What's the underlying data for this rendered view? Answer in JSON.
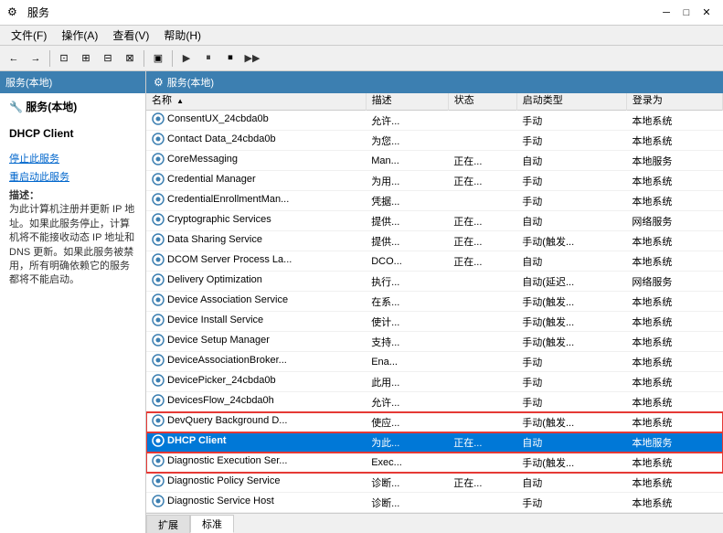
{
  "titleBar": {
    "icon": "⚙",
    "title": "服务",
    "minimizeLabel": "─",
    "maximizeLabel": "□",
    "closeLabel": "✕"
  },
  "menuBar": {
    "items": [
      "文件(F)",
      "操作(A)",
      "查看(V)",
      "帮助(H)"
    ]
  },
  "toolbar": {
    "buttons": [
      "←",
      "→",
      "⊡",
      "⊞",
      "⊟",
      "⊠",
      "|",
      "▣",
      "|",
      "▶",
      "⏸",
      "⏹",
      "▶"
    ]
  },
  "leftPanel": {
    "header": "服务(本地)",
    "selectedServiceName": "DHCP Client",
    "stopLink": "停止此服务",
    "restartLink": "重启动此服务",
    "descriptionLabel": "描述：",
    "description": "为此计算机注册并更新 IP 地址。如果此服务停止，计算机将不能接收动态 IP 地址和 DNS 更新。如果此服务被禁用，所有明确依赖它的服务都将不能启动。"
  },
  "rightPanel": {
    "header": "服务(本地)",
    "columns": [
      "名称",
      "描述",
      "状态",
      "启动类型",
      "登录为"
    ],
    "sortColumn": "名称",
    "rows": [
      {
        "name": "ConsentUX_24cbda0b",
        "desc": "允许...",
        "status": "",
        "startup": "手动",
        "login": "本地系统"
      },
      {
        "name": "Contact Data_24cbda0b",
        "desc": "为您...",
        "status": "",
        "startup": "手动",
        "login": "本地系统"
      },
      {
        "name": "CoreMessaging",
        "desc": "Man...",
        "status": "正在...",
        "startup": "自动",
        "login": "本地服务"
      },
      {
        "name": "Credential Manager",
        "desc": "为用...",
        "status": "正在...",
        "startup": "手动",
        "login": "本地系统"
      },
      {
        "name": "CredentialEnrollmentMan...",
        "desc": "凭据...",
        "status": "",
        "startup": "手动",
        "login": "本地系统"
      },
      {
        "name": "Cryptographic Services",
        "desc": "提供...",
        "status": "正在...",
        "startup": "自动",
        "login": "网络服务"
      },
      {
        "name": "Data Sharing Service",
        "desc": "提供...",
        "status": "正在...",
        "startup": "手动(触发...",
        "login": "本地系统"
      },
      {
        "name": "DCOM Server Process La...",
        "desc": "DCO...",
        "status": "正在...",
        "startup": "自动",
        "login": "本地系统"
      },
      {
        "name": "Delivery Optimization",
        "desc": "执行...",
        "status": "",
        "startup": "自动(延迟...",
        "login": "网络服务"
      },
      {
        "name": "Device Association Service",
        "desc": "在系...",
        "status": "",
        "startup": "手动(触发...",
        "login": "本地系统"
      },
      {
        "name": "Device Install Service",
        "desc": "使计...",
        "status": "",
        "startup": "手动(触发...",
        "login": "本地系统"
      },
      {
        "name": "Device Setup Manager",
        "desc": "支持...",
        "status": "",
        "startup": "手动(触发...",
        "login": "本地系统"
      },
      {
        "name": "DeviceAssociationBroker...",
        "desc": "Ena...",
        "status": "",
        "startup": "手动",
        "login": "本地系统"
      },
      {
        "name": "DevicePicker_24cbda0b",
        "desc": "此用...",
        "status": "",
        "startup": "手动",
        "login": "本地系统"
      },
      {
        "name": "DevicesFlow_24cbda0h",
        "desc": "允许...",
        "status": "",
        "startup": "手动",
        "login": "本地系统"
      },
      {
        "name": "DevQuery Background D...",
        "desc": "使应...",
        "status": "",
        "startup": "手动(触发...",
        "login": "本地系统",
        "highlight": "above"
      },
      {
        "name": "DHCP Client",
        "desc": "为此...",
        "status": "正在...",
        "startup": "自动",
        "login": "本地服务",
        "selected": true
      },
      {
        "name": "Diagnostic Execution Ser...",
        "desc": "Exec...",
        "status": "",
        "startup": "手动(触发...",
        "login": "本地系统",
        "highlight": "below"
      },
      {
        "name": "Diagnostic Policy Service",
        "desc": "诊断...",
        "status": "正在...",
        "startup": "自动",
        "login": "本地系统"
      },
      {
        "name": "Diagnostic Service Host",
        "desc": "诊断...",
        "status": "",
        "startup": "手动",
        "login": "本地系统"
      }
    ]
  },
  "bottomTabs": {
    "tabs": [
      "扩展",
      "标准"
    ],
    "activeTab": "标准"
  }
}
